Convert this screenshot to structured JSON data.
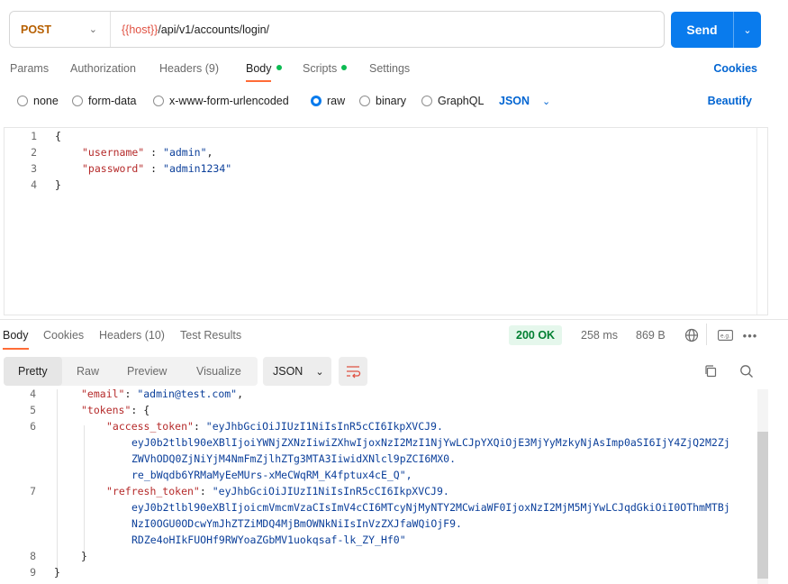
{
  "request": {
    "method": "POST",
    "url_var": "{{host}}",
    "url_path": "/api/v1/accounts/login/",
    "send_label": "Send"
  },
  "request_tabs": {
    "params": "Params",
    "authorization": "Authorization",
    "headers": "Headers (9)",
    "body": "Body",
    "scripts": "Scripts",
    "settings": "Settings",
    "cookies": "Cookies",
    "dot_color": "#0cbb52"
  },
  "body_options": {
    "none": "none",
    "form_data": "form-data",
    "urlencoded": "x-www-form-urlencoded",
    "raw": "raw",
    "binary": "binary",
    "graphql": "GraphQL",
    "format": "JSON",
    "beautify": "Beautify",
    "selected": "raw"
  },
  "request_body": {
    "line_numbers": [
      "1",
      "2",
      "3",
      "4"
    ],
    "open": "{",
    "close": "}",
    "username_key": "\"username\"",
    "username_value": "\"admin\"",
    "password_key": "\"password\"",
    "password_value": "\"admin1234\""
  },
  "response_tabs": {
    "body": "Body",
    "cookies": "Cookies",
    "headers": "Headers (10)",
    "test_results": "Test Results",
    "status": "200 OK",
    "time": "258 ms",
    "size": "869 B"
  },
  "response_toolbar": {
    "pretty": "Pretty",
    "raw": "Raw",
    "preview": "Preview",
    "visualize": "Visualize",
    "format": "JSON"
  },
  "response_body": {
    "line_numbers": [
      "4",
      "5",
      "6",
      "7",
      "8",
      "9"
    ],
    "email_key": "\"email\"",
    "email_value": "\"admin@test.com\"",
    "tokens_key": "\"tokens\"",
    "access_key": "\"access_token\"",
    "access_lines": [
      "\"eyJhbGciOiJIUzI1NiIsInR5cCI6IkpXVCJ9.",
      "eyJ0b2tlbl90eXBlIjoiYWNjZXNzIiwiZXhwIjoxNzI2MzI1NjYwLCJpYXQiOjE3MjYyMzkyNjAsImp0aSI6IjY4ZjQ2M2Zj",
      "ZWVhODQ0ZjNiYjM4NmFmZjlhZTg3MTA3IiwidXNlcl9pZCI6MX0.",
      "re_bWqdb6YRMaMyEeMUrs-xMeCWqRM_K4fptux4cE_Q\","
    ],
    "refresh_key": "\"refresh_token\"",
    "refresh_lines": [
      "\"eyJhbGciOiJIUzI1NiIsInR5cCI6IkpXVCJ9.",
      "eyJ0b2tlbl90eXBlIjoicmVmcmVzaCIsImV4cCI6MTcyNjMyNTY2MCwiaWF0IjoxNzI2MjM5MjYwLCJqdGkiOiI0OThmMTBj",
      "NzI0OGU0ODcwYmJhZTZiMDQ4MjBmOWNkNiIsInVzZXJfaWQiOjF9.",
      "RDZe4oHIkFUOHf9RWYoaZGbMV1uokqsaf-lk_ZY_Hf0\""
    ],
    "inner_close": "}",
    "outer_close": "}"
  },
  "colors": {
    "accent": "#097bed",
    "tab_indicator": "#ff6c37",
    "method": "#b65f00",
    "status_bg": "#e5f7ec",
    "status_text": "#007f31"
  }
}
